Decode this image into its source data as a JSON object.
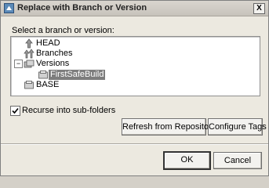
{
  "window": {
    "title": "Replace with Branch or Version",
    "close_symbol": "X"
  },
  "prompt": {
    "label": "Select a branch or version:"
  },
  "tree": {
    "head": "HEAD",
    "branches": "Branches",
    "versions": "Versions",
    "selected": "FirstSafeBuild",
    "base": "BASE",
    "collapse_symbol": "−",
    "expand_symbol": "+"
  },
  "options": {
    "recurse_label": "Recurse into sub-folders",
    "recurse_checked": true
  },
  "buttons": {
    "refresh": "Refresh from Repository",
    "configure": "Configure Tags",
    "ok": "OK",
    "cancel": "Cancel"
  }
}
